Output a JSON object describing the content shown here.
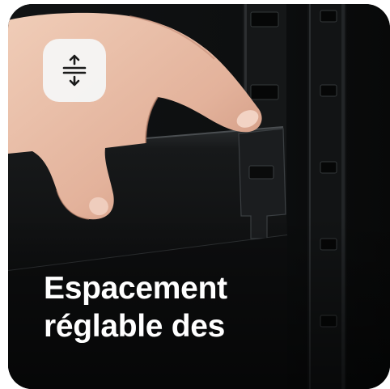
{
  "badge": {
    "icon": "adjust-spacing-icon"
  },
  "caption": {
    "line1": "Espacement",
    "line2": "réglable des"
  },
  "colors": {
    "background": "#0b0c0d",
    "badge": "#f5f5f5",
    "text": "#ffffff",
    "skin": "#e3b9a3"
  }
}
